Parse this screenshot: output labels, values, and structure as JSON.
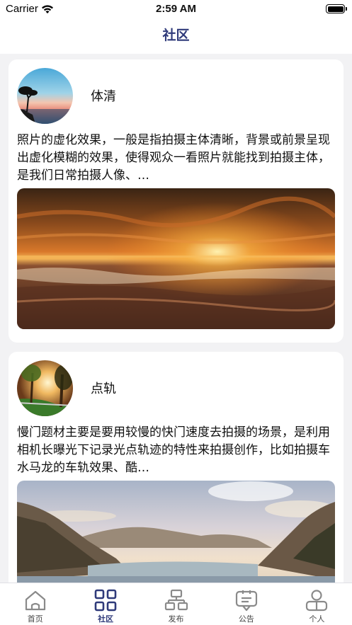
{
  "status": {
    "carrier": "Carrier",
    "time": "2:59 AM"
  },
  "nav": {
    "title": "社区"
  },
  "posts": [
    {
      "username": "体清",
      "text": "照片的虚化效果，一般是指拍摄主体清晰，背景或前景呈现出虚化模糊的效果，使得观众一看照片就能找到拍摄主体，是我们日常拍摄人像、…"
    },
    {
      "username": "点轨",
      "text": "慢门题材主要是要用较慢的快门速度去拍摄的场景，是利用相机长曝光下记录光点轨迹的特性来拍摄创作，比如拍摄车水马龙的车轨效果、酷…"
    }
  ],
  "tabs": [
    {
      "label": "首页",
      "icon": "home-icon",
      "active": false
    },
    {
      "label": "社区",
      "icon": "grid-icon",
      "active": true
    },
    {
      "label": "发布",
      "icon": "publish-icon",
      "active": false
    },
    {
      "label": "公告",
      "icon": "announcement-icon",
      "active": false
    },
    {
      "label": "个人",
      "icon": "profile-icon",
      "active": false
    }
  ],
  "colors": {
    "accent": "#2f3a7a",
    "inactive": "#8a8a8a",
    "background": "#f2f2f4"
  }
}
